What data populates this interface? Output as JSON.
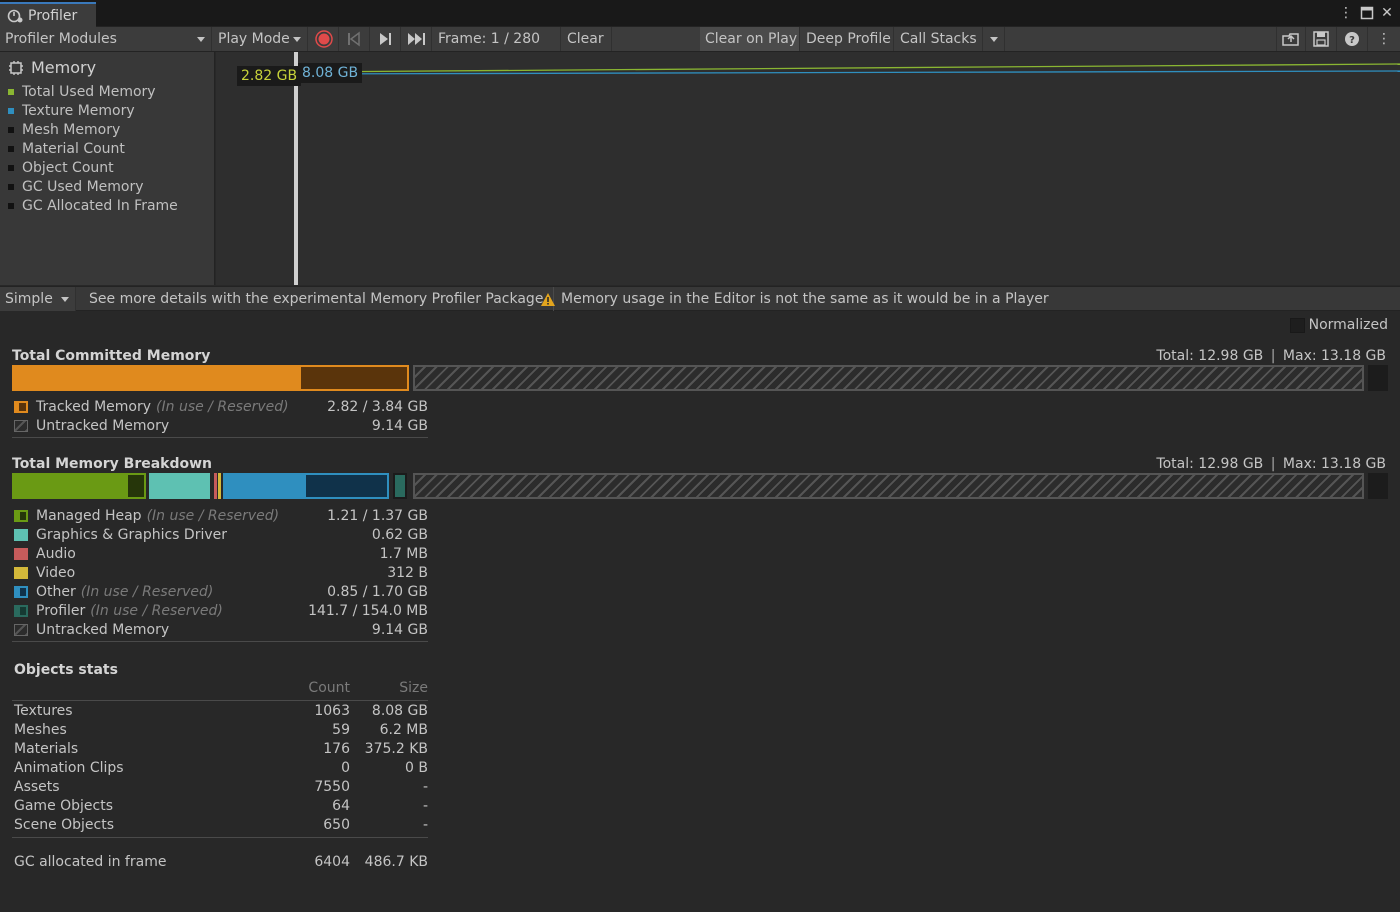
{
  "window": {
    "tab_label": "Profiler",
    "icons": [
      "profiler-tab-icon",
      "kebab-menu-icon",
      "maximize-icon",
      "close-icon"
    ]
  },
  "toolbar": {
    "modules_dropdown": "Profiler Modules",
    "target_dropdown": "Play Mode",
    "frame_label": "Frame: 1 / 280",
    "clear": "Clear",
    "clear_on_play": "Clear on Play",
    "deep_profile": "Deep Profile",
    "call_stacks": "Call Stacks",
    "icons": [
      "record-icon",
      "first-frame-icon",
      "next-frame-icon",
      "last-frame-icon",
      "load-icon",
      "save-icon",
      "help-icon",
      "more-icon"
    ]
  },
  "modules": {
    "title": "Memory",
    "items": [
      {
        "label": "Total Used Memory",
        "color": "#8ab632"
      },
      {
        "label": "Texture Memory",
        "color": "#2f8fbf"
      },
      {
        "label": "Mesh Memory",
        "color": "#111111"
      },
      {
        "label": "Material Count",
        "color": "#111111"
      },
      {
        "label": "Object Count",
        "color": "#111111"
      },
      {
        "label": "GC Used Memory",
        "color": "#111111"
      },
      {
        "label": "GC Allocated In Frame",
        "color": "#111111"
      }
    ]
  },
  "chart": {
    "value_label_1": "2.82 GB",
    "value_label_2": "8.08 GB",
    "label_1_color": "#c8d33a",
    "label_2_color": "#6fb2d6"
  },
  "bar2": {
    "view_dropdown": "Simple",
    "details_message": "See more details with the experimental Memory Profiler Package.",
    "warning_message": "Memory usage in the Editor is not the same as it would be in a Player"
  },
  "detail": {
    "normalized_label": "Normalized",
    "committed": {
      "title": "Total Committed Memory",
      "total": "Total: 12.98 GB",
      "max": "Max: 13.18 GB",
      "rows": [
        {
          "label": "Tracked Memory",
          "hint": "(In use / Reserved)",
          "value": "2.82 / 3.84 GB",
          "color": "#e08a1e"
        },
        {
          "label": "Untracked Memory",
          "hint": "",
          "value": "9.14 GB",
          "color": "#555555"
        }
      ]
    },
    "breakdown": {
      "title": "Total Memory Breakdown",
      "total": "Total: 12.98 GB",
      "max": "Max: 13.18 GB",
      "rows": [
        {
          "label": "Managed Heap",
          "hint": "(In use / Reserved)",
          "value": "1.21 / 1.37 GB",
          "color": "#6a9a14"
        },
        {
          "label": "Graphics & Graphics Driver",
          "hint": "",
          "value": "0.62 GB",
          "color": "#5ec1b2"
        },
        {
          "label": "Audio",
          "hint": "",
          "value": "1.7 MB",
          "color": "#c65b5b"
        },
        {
          "label": "Video",
          "hint": "",
          "value": "312 B",
          "color": "#d3b83a"
        },
        {
          "label": "Other",
          "hint": "(In use / Reserved)",
          "value": "0.85 / 1.70 GB",
          "color": "#2f8fbf"
        },
        {
          "label": "Profiler",
          "hint": "(In use / Reserved)",
          "value": "141.7 / 154.0 MB",
          "color": "#2a6a5e"
        },
        {
          "label": "Untracked Memory",
          "hint": "",
          "value": "9.14 GB",
          "color": "#555555"
        }
      ]
    },
    "objects": {
      "title": "Objects stats",
      "col_count": "Count",
      "col_size": "Size",
      "rows": [
        {
          "name": "Textures",
          "count": "1063",
          "size": "8.08 GB"
        },
        {
          "name": "Meshes",
          "count": "59",
          "size": "6.2 MB"
        },
        {
          "name": "Materials",
          "count": "176",
          "size": "375.2 KB"
        },
        {
          "name": "Animation Clips",
          "count": "0",
          "size": "0 B"
        },
        {
          "name": "Assets",
          "count": "7550",
          "size": "-"
        },
        {
          "name": "Game Objects",
          "count": "64",
          "size": "-"
        },
        {
          "name": "Scene Objects",
          "count": "650",
          "size": "-"
        }
      ],
      "gc": {
        "name": "GC allocated in frame",
        "count": "6404",
        "size": "486.7 KB"
      }
    }
  }
}
